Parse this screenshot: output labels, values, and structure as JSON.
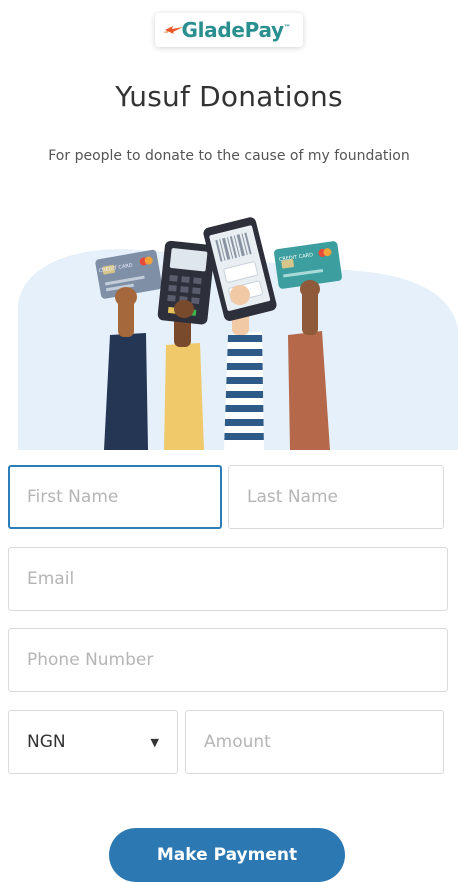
{
  "brand": {
    "logo_text": "GladePay",
    "trademark": "™",
    "accent": "#2a8f8f"
  },
  "page": {
    "title": "Yusuf Donations",
    "subtitle": "For people to donate to the cause of my foundation"
  },
  "illustration": {
    "icon": "hands-holding-payment-devices",
    "card_label": "CREDIT CARD"
  },
  "form": {
    "first_name": {
      "placeholder": "First Name",
      "value": ""
    },
    "last_name": {
      "placeholder": "Last Name",
      "value": ""
    },
    "email": {
      "placeholder": "Email",
      "value": ""
    },
    "phone": {
      "placeholder": "Phone Number",
      "value": ""
    },
    "currency": {
      "selected": "NGN",
      "caret": "▼"
    },
    "amount": {
      "placeholder": "Amount",
      "value": ""
    },
    "submit_label": "Make Payment"
  },
  "colors": {
    "primary_button": "#2c78b3",
    "focus_border": "#2c7cb5",
    "blob": "#e6f0fa"
  }
}
